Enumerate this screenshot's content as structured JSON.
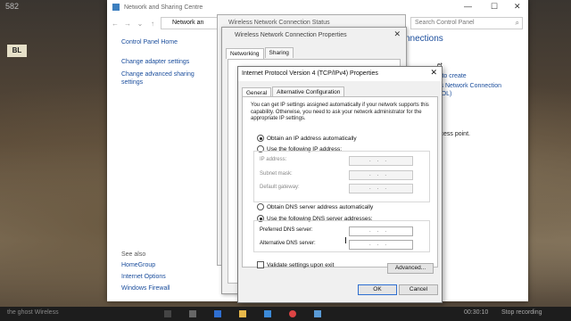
{
  "wallpaper": {
    "sign": "BL",
    "number": "582"
  },
  "main_window": {
    "title": "Network and Sharing Centre",
    "address": "Network an",
    "search_placeholder": "Search Control Panel",
    "controls": {
      "minimize": "—",
      "maximize": "☐",
      "close": "✕"
    },
    "left_pane": {
      "home": "Control Panel Home",
      "change_adapter": "Change adapter settings",
      "change_advanced": "Change advanced sharing settings",
      "see_also": "See also",
      "homegroup": "HomeGroup",
      "internet_options": "Internet Options",
      "windows_firewall": "Windows Firewall"
    },
    "right_fragments": {
      "heading": "nnections",
      "line1": "et",
      "line2": "y to create",
      "line3": "ss Network Connection",
      "line4": "SOL)",
      "line5": "ccess point."
    }
  },
  "status_window": {
    "title": "Wireless Network Connection Status"
  },
  "props_window": {
    "title": "Wireless Network Connection Properties",
    "tabs": [
      "Networking",
      "Sharing"
    ]
  },
  "ipv4_dialog": {
    "title": "Internet Protocol Version 4 (TCP/IPv4) Properties",
    "tabs": [
      "General",
      "Alternative Configuration"
    ],
    "intro": "You can get IP settings assigned automatically if your network supports this capability. Otherwise, you need to ask your network administrator for the appropriate IP settings.",
    "obtain_ip_auto": "Obtain an IP address automatically",
    "use_following_ip": "Use the following IP address:",
    "ip_address_label": "IP address:",
    "subnet_mask_label": "Subnet mask:",
    "default_gateway_label": "Default gateway:",
    "obtain_dns_auto": "Obtain DNS server address automatically",
    "use_following_dns": "Use the following DNS server addresses:",
    "preferred_dns_label": "Preferred DNS server:",
    "alternative_dns_label": "Alternative DNS server:",
    "ip_placeholder": "...",
    "validate_label": "Validate settings upon exit",
    "advanced_button": "Advanced...",
    "ok_button": "OK",
    "cancel_button": "Cancel",
    "selected_ip_option": "auto",
    "selected_dns_option": "manual",
    "validate_checked": false
  },
  "taskbar": {
    "left_text": "the ghost Wireless",
    "time": "00:30:10",
    "recording": "Stop recording"
  }
}
